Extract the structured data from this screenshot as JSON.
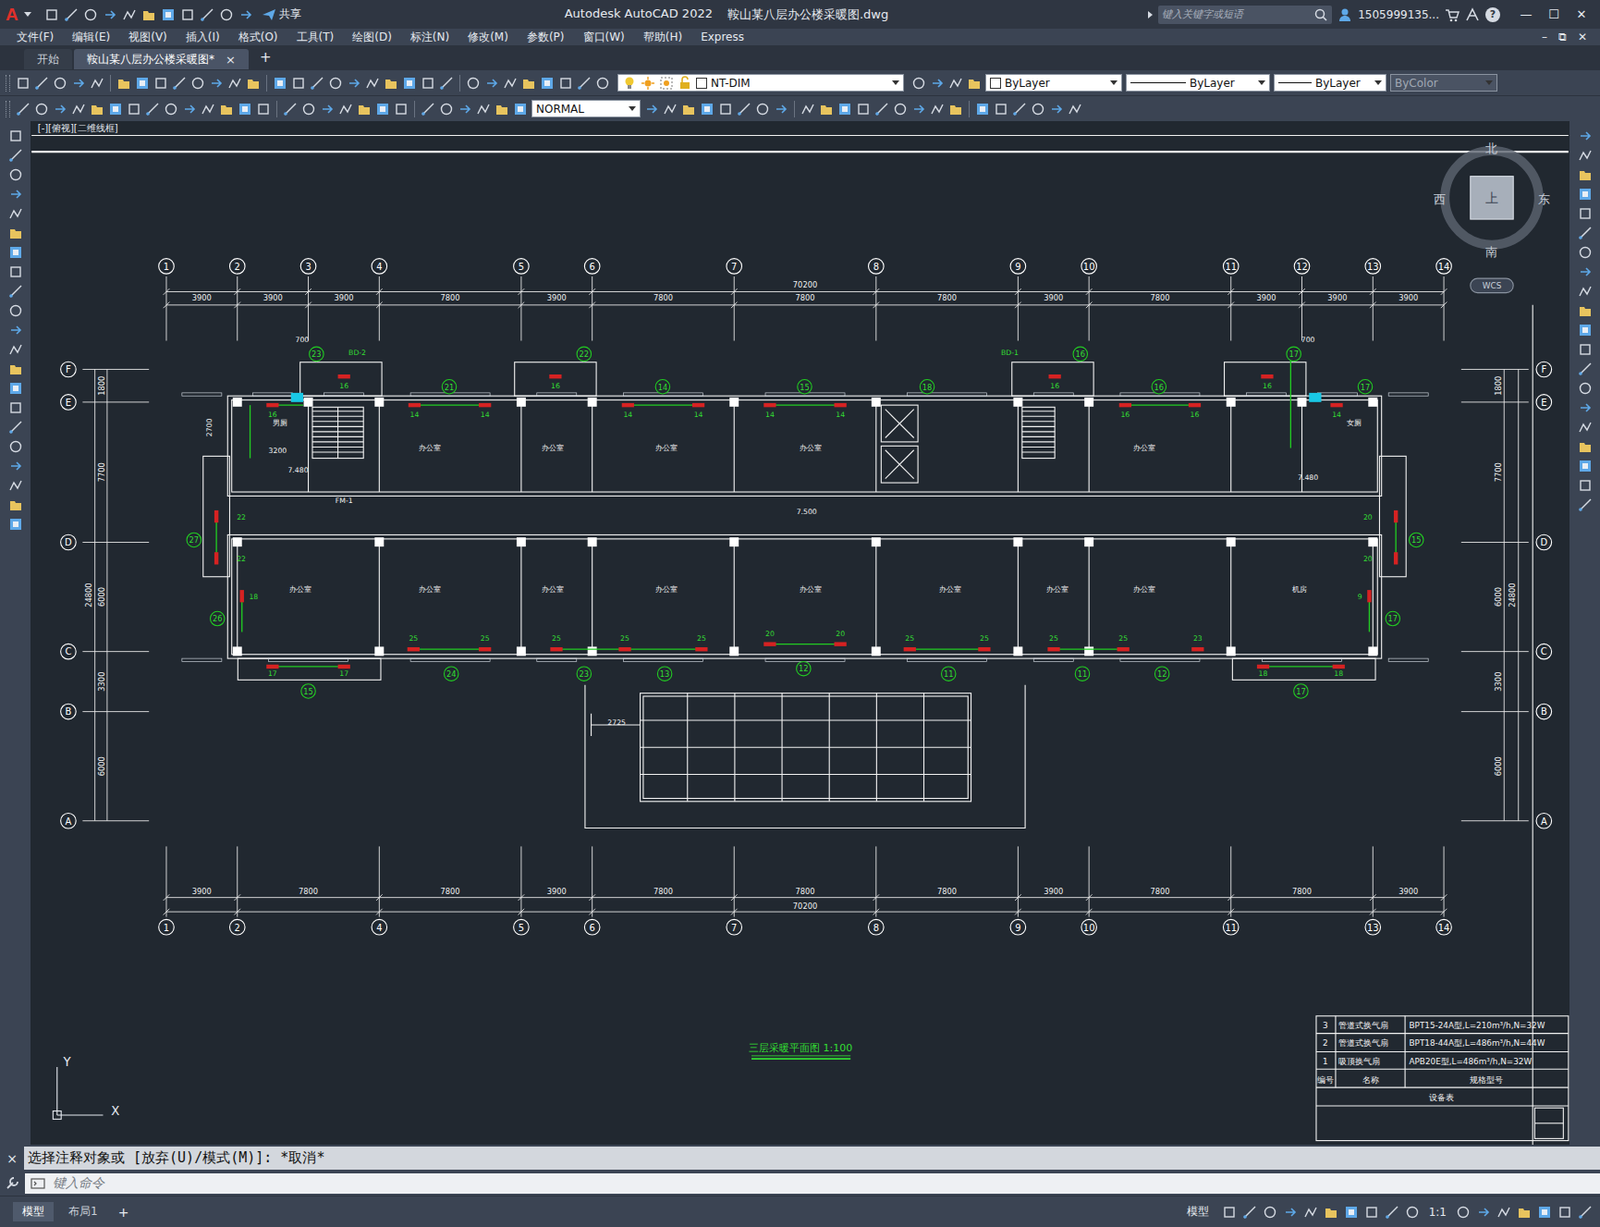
{
  "window": {
    "logo": "A",
    "app": "Autodesk AutoCAD 2022",
    "file": "鞍山某八层办公楼采暖图.dwg",
    "share": "共享",
    "search_placeholder": "键入关键字或短语",
    "user": "1505999135...",
    "help": "?",
    "controls": [
      "—",
      "☐",
      "✕"
    ]
  },
  "menu": {
    "items": [
      "文件(F)",
      "编辑(E)",
      "视图(V)",
      "插入(I)",
      "格式(O)",
      "工具(T)",
      "绘图(D)",
      "标注(N)",
      "修改(M)",
      "参数(P)",
      "窗口(W)",
      "帮助(H)",
      "Express"
    ],
    "doc_controls": [
      "–",
      "⧉",
      "✕"
    ]
  },
  "tabs": [
    {
      "label": "开始",
      "selected": false,
      "closable": false
    },
    {
      "label": "鞍山某八层办公楼采暖图*",
      "selected": true,
      "closable": true
    }
  ],
  "tab_close": "×",
  "tab_add": "+",
  "properties": {
    "layer": "NT-DIM",
    "color": "ByLayer",
    "linetype": "ByLayer",
    "lineweight": "ByLayer",
    "plot_style": "ByColor",
    "plot_style_disabled": true,
    "text_style": "NORMAL"
  },
  "viewport": {
    "label": "[-][俯视][二维线框]"
  },
  "viewcube": {
    "north": "北",
    "south": "南",
    "east": "东",
    "west": "西",
    "top": "上",
    "ucs": "WCS"
  },
  "plan": {
    "x_axes": [
      "1",
      "2",
      "3",
      "4",
      "5",
      "6",
      "7",
      "8",
      "9",
      "10",
      "11",
      "12",
      "13",
      "14"
    ],
    "top_dims": [
      "3900",
      "3900",
      "3900",
      "7800",
      "3900",
      "7800",
      "7800",
      "7800",
      "3900",
      "7800",
      "3900",
      "3900",
      "3900"
    ],
    "top_total": "70200",
    "bottom_axes": [
      "1",
      "2",
      "4",
      "5",
      "6",
      "7",
      "8",
      "9",
      "10",
      "11",
      "13",
      "14"
    ],
    "bottom_dims": [
      "3900",
      "7800",
      "7800",
      "3900",
      "7800",
      "7800",
      "7800",
      "3900",
      "7800",
      "7800",
      "3900"
    ],
    "bottom_total": "70200",
    "y_axes": [
      "F",
      "E",
      "D",
      "C",
      "B",
      "A"
    ],
    "side_dims": [
      "1800",
      "7700",
      "6000",
      "3300",
      "6000"
    ],
    "side_total": "24800",
    "rooms": [
      "办公室",
      "办公室",
      "办公室",
      "办公室",
      "办公室",
      "男厕",
      "女厕",
      "办公室",
      "办公室",
      "办公室",
      "办公室",
      "办公室",
      "办公室",
      "办公室",
      "办公室",
      "机房"
    ],
    "tags": [
      "23",
      "22",
      "21",
      "14",
      "15",
      "18",
      "16",
      "16",
      "17",
      "17",
      "27",
      "26",
      "15",
      "17",
      "15",
      "24",
      "23",
      "13",
      "12",
      "11",
      "11",
      "12",
      "17"
    ],
    "radiators": [
      "16",
      "16",
      "14",
      "14",
      "16",
      "14",
      "14",
      "14",
      "14",
      "16",
      "16",
      "16",
      "16",
      "14",
      "22",
      "22",
      "18",
      "20",
      "20",
      "9",
      "17",
      "17",
      "25",
      "25",
      "25",
      "25",
      "25",
      "20",
      "20",
      "25",
      "25",
      "25",
      "25",
      "23",
      "18",
      "18"
    ],
    "notes": [
      "7.500",
      "7.480",
      "7.480",
      "3200",
      "2725",
      "FM-1",
      "BD-2",
      "BD-1",
      "700",
      "700",
      "2700"
    ],
    "title": "三层采暖平面图 1:100"
  },
  "equipment": {
    "rows": [
      {
        "no": "3",
        "name": "管道式换气扇",
        "spec": "BPT15-24A型,L=210m³/h,N=32W"
      },
      {
        "no": "2",
        "name": "管道式换气扇",
        "spec": "BPT18-44A型,L=486m³/h,N=44W"
      },
      {
        "no": "1",
        "name": "吸顶换气扇",
        "spec": "APB20E型,L=486m³/h,N=32W"
      }
    ],
    "header": {
      "no": "编号",
      "name": "名称",
      "spec": "规格型号"
    },
    "caption": "设备表"
  },
  "ucs_icon": {
    "x": "X",
    "y": "Y"
  },
  "command": {
    "close": "×",
    "history": "选择注释对象或 [放弃(U)/模式(M)]: *取消*",
    "placeholder": "键入命令"
  },
  "status": {
    "layouts": [
      {
        "label": "模型",
        "selected": true
      },
      {
        "label": "布局1",
        "selected": false
      }
    ],
    "add": "+",
    "space": "模型",
    "scale": "1:1"
  }
}
